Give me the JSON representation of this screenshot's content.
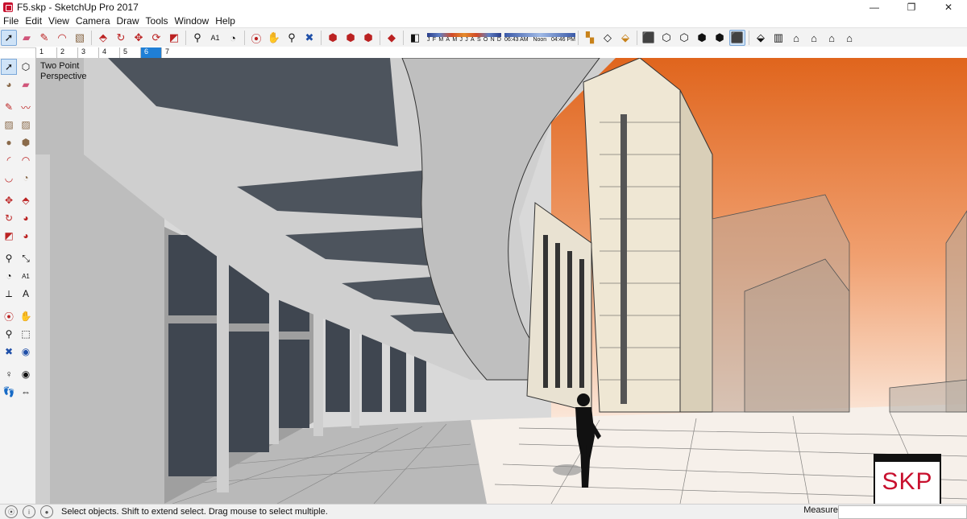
{
  "window": {
    "title": "F5.skp - SketchUp Pro 2017",
    "minimize": "—",
    "restore": "❐",
    "close": "✕"
  },
  "menu": [
    "File",
    "Edit",
    "View",
    "Camera",
    "Draw",
    "Tools",
    "Window",
    "Help"
  ],
  "toolbar": {
    "tools_a": [
      "select-icon",
      "eraser-icon",
      "pencil-icon",
      "arc-icon",
      "paint-bucket-icon"
    ],
    "tools_b": [
      "push-pull-icon",
      "rotate-icon",
      "move-icon",
      "follow-me-icon",
      "scale-icon",
      "offset-icon"
    ],
    "tools_c": [
      "tape-measure-icon",
      "text-icon",
      "protractor-icon",
      "dimension-icon",
      "orbit-icon",
      "pan-icon",
      "zoom-icon",
      "zoom-extents-icon"
    ],
    "tools_d": [
      "warehouse-icon",
      "extension-icon",
      "layout-icon",
      "ruby-icon"
    ],
    "shadow": {
      "months": [
        "J",
        "F",
        "M",
        "A",
        "M",
        "J",
        "J",
        "A",
        "S",
        "O",
        "N",
        "D"
      ],
      "time_start": "06:43 AM",
      "time_mid": "Noon",
      "time_end": "04:46 PM"
    },
    "tools_e": [
      "section-icon",
      "section-display-icon",
      "component-icon",
      "xray-icon",
      "hidden-line-icon",
      "shaded-icon",
      "textured-icon",
      "monochrome-icon"
    ],
    "tools_f": [
      "iso-view-icon",
      "top-view-icon",
      "front-view-icon",
      "right-view-icon",
      "back-view-icon",
      "left-view-icon"
    ]
  },
  "scene_tabs": [
    "1",
    "2",
    "3",
    "4",
    "5",
    "6",
    "7"
  ],
  "active_scene": "6",
  "viewport": {
    "label_line1": "Two Point",
    "label_line2": "Perspective"
  },
  "status": {
    "text": "Select objects. Shift to extend select. Drag mouse to select multiple.",
    "measurements_label": "Measurements"
  },
  "logo": {
    "text": "SKP"
  }
}
